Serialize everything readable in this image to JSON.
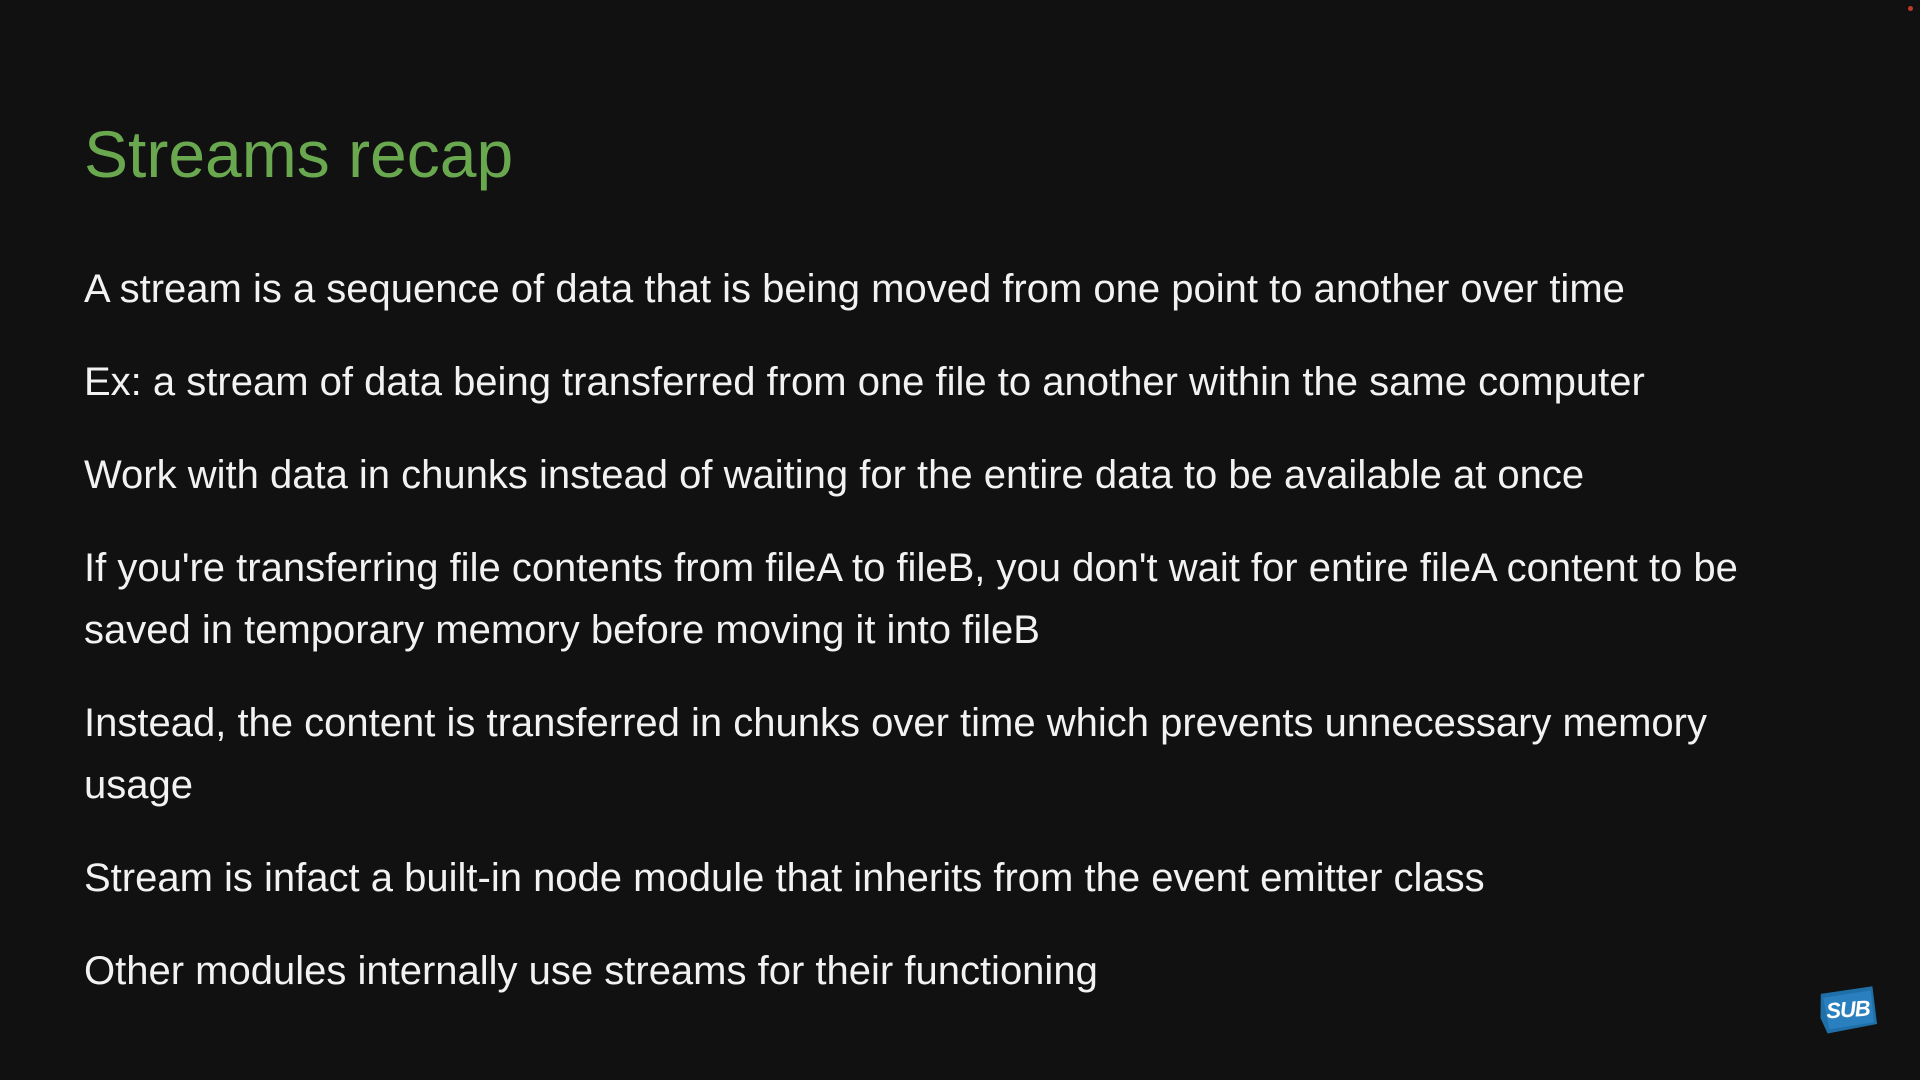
{
  "slide": {
    "title": "Streams recap",
    "bullets": [
      "A stream is a sequence of data that is being moved from one point to another over time",
      "Ex: a stream of data being transferred from one file to another within the same computer",
      "Work with data in chunks instead of waiting for the entire data to be available at once",
      "If you're transferring file contents from fileA to fileB, you don't wait for entire fileA content to be saved in temporary memory before moving it into fileB",
      "Instead, the content is transferred in chunks over time which prevents unnecessary memory usage",
      "Stream is infact a built-in node module that inherits from the event emitter class",
      "Other modules internally use streams for their functioning"
    ]
  },
  "badge": {
    "label": "SUB",
    "color": "#1f6fa8"
  },
  "colors": {
    "background": "#111111",
    "title": "#6aa84f",
    "text": "#f2f2f2"
  }
}
